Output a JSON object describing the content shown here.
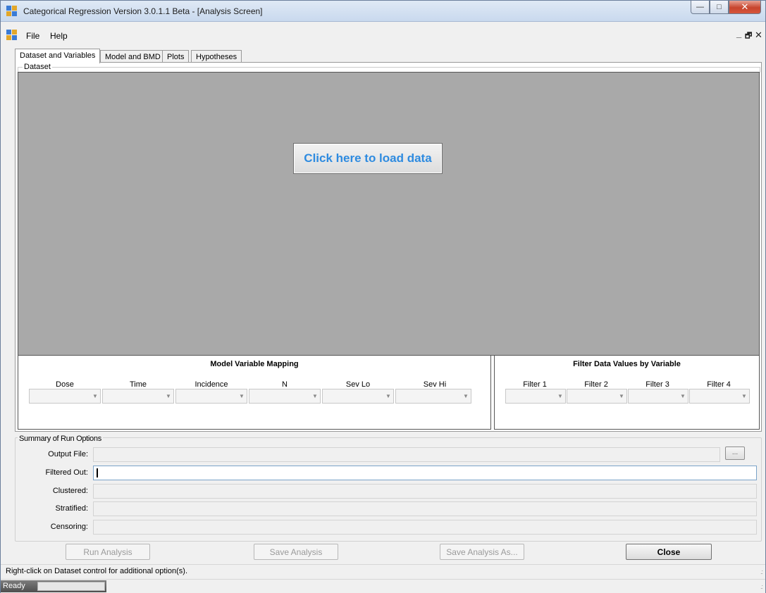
{
  "window": {
    "title": "Categorical Regression Version 3.0.1.1 Beta - [Analysis Screen]",
    "controls": {
      "minimize": "—",
      "maximize": "□",
      "close": "✕"
    }
  },
  "menu": {
    "items": [
      "File",
      "Help"
    ],
    "mdi_controls": {
      "minimize": "_",
      "restore": "🗗",
      "close": "✕"
    }
  },
  "tabs": [
    "Dataset and Variables",
    "Model and BMD",
    "Plots",
    "Hypotheses"
  ],
  "dataset": {
    "group_label": "Dataset",
    "load_button": "Click here to load data"
  },
  "model_mapping": {
    "title": "Model Variable Mapping",
    "columns": [
      "Dose",
      "Time",
      "Incidence",
      "N",
      "Sev Lo",
      "Sev Hi"
    ]
  },
  "filter": {
    "title": "Filter Data Values by Variable",
    "columns": [
      "Filter 1",
      "Filter 2",
      "Filter 3",
      "Filter 4"
    ]
  },
  "summary": {
    "group_label": "Summary of Run Options",
    "fields": [
      {
        "label": "Output File:",
        "value": ""
      },
      {
        "label": "Filtered Out:",
        "value": ""
      },
      {
        "label": "Clustered:",
        "value": ""
      },
      {
        "label": "Stratified:",
        "value": ""
      },
      {
        "label": "Censoring:",
        "value": ""
      }
    ],
    "browse_label": "..."
  },
  "actions": {
    "run": "Run Analysis",
    "save": "Save Analysis",
    "save_as": "Save Analysis As...",
    "close": "Close"
  },
  "hint": "Right-click on Dataset control for additional option(s).",
  "status": {
    "text": "Ready"
  },
  "colors": {
    "data_area": "#a9a9a9",
    "load_button_text": "#2e8be0",
    "close_button": "#c7452e"
  }
}
